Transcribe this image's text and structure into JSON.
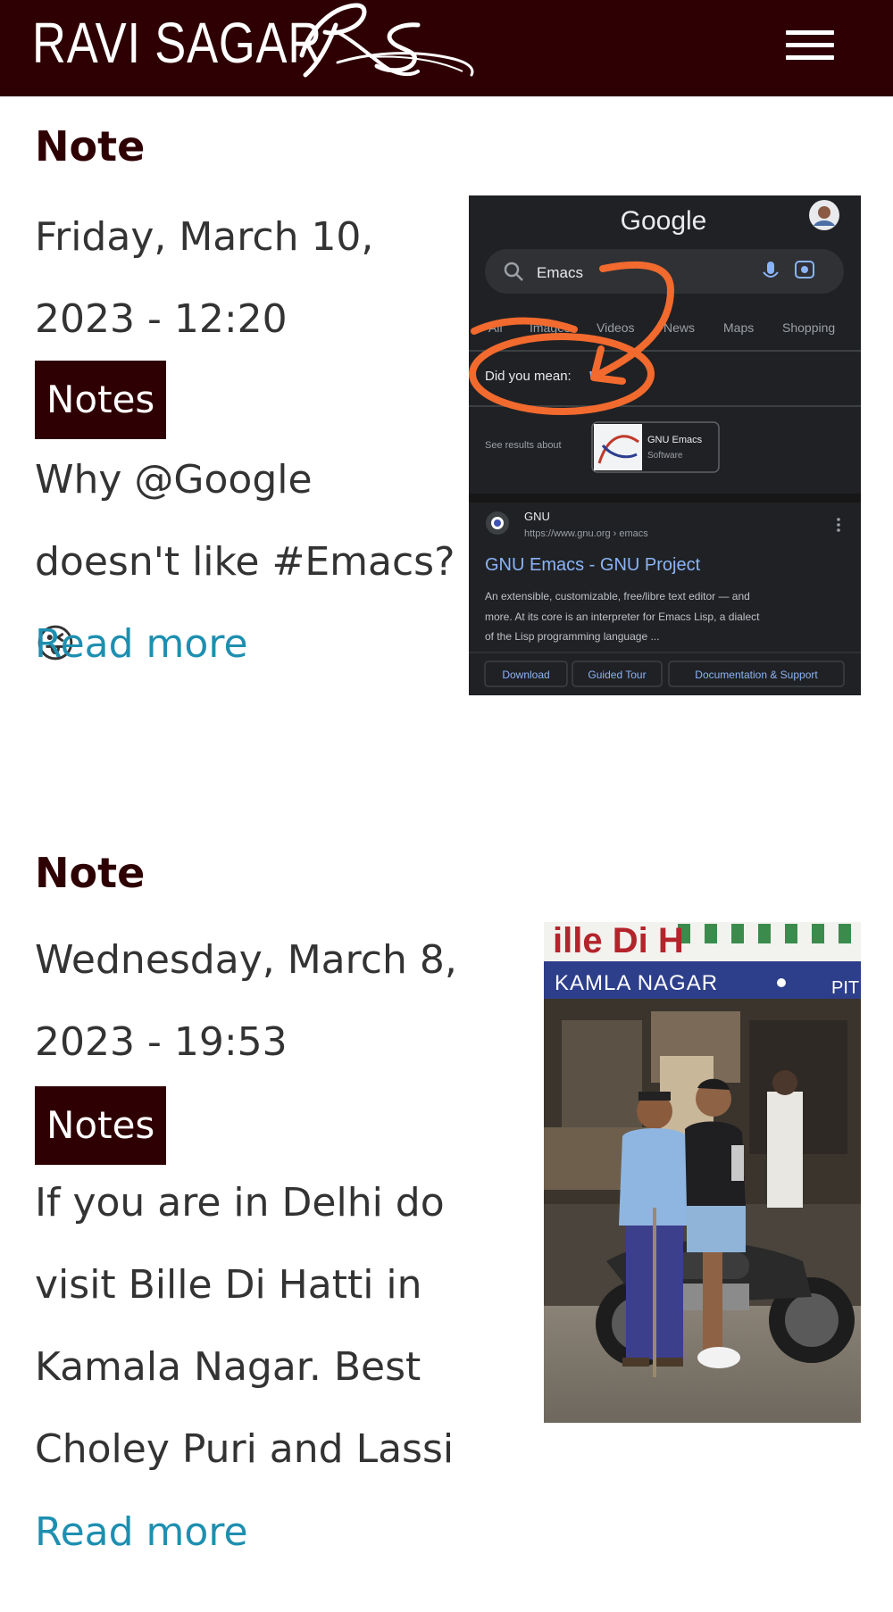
{
  "site": {
    "name": "RAVI SAGAR",
    "logo_monogram": "RS"
  },
  "header": {
    "menu_icon": "hamburger-menu-icon"
  },
  "notes": [
    {
      "title": "Note",
      "date": "Friday, March 10, 2023 - 12:20",
      "tag": "Notes",
      "body": "Why @Google doesn't like #Emacs? 😜",
      "read_more": "Read more",
      "image": {
        "google_logo": "Google",
        "search_query": "Emacs",
        "tabs": [
          "All",
          "Images",
          "Videos",
          "News",
          "Maps",
          "Shopping"
        ],
        "did_you_mean_label": "Did you mean:",
        "did_you_mean_value": "Vi",
        "see_results_about": "See results about",
        "knowledge_title": "GNU Emacs",
        "knowledge_subtitle": "Software",
        "result_source": "GNU",
        "result_url": "https://www.gnu.org › emacs",
        "result_title": "GNU Emacs - GNU Project",
        "result_snippet": [
          "An extensible, customizable, free/libre text editor — and",
          "more. At its core is an interpreter for Emacs Lisp, a dialect",
          "of the Lisp programming language ..."
        ],
        "sitelinks": [
          "Download",
          "Guided Tour",
          "Documentation & Support"
        ]
      }
    },
    {
      "title": "Note",
      "date": "Wednesday, March 8, 2023 - 19:53",
      "tag": "Notes",
      "body": "If you are in Delhi do visit Bille Di Hatti in Kamala Nagar. Best Choley Puri and Lassi",
      "read_more": "Read more",
      "image": {
        "sign_text": "KAMLA NAGAR",
        "sign_partial": "PIT"
      }
    }
  ]
}
